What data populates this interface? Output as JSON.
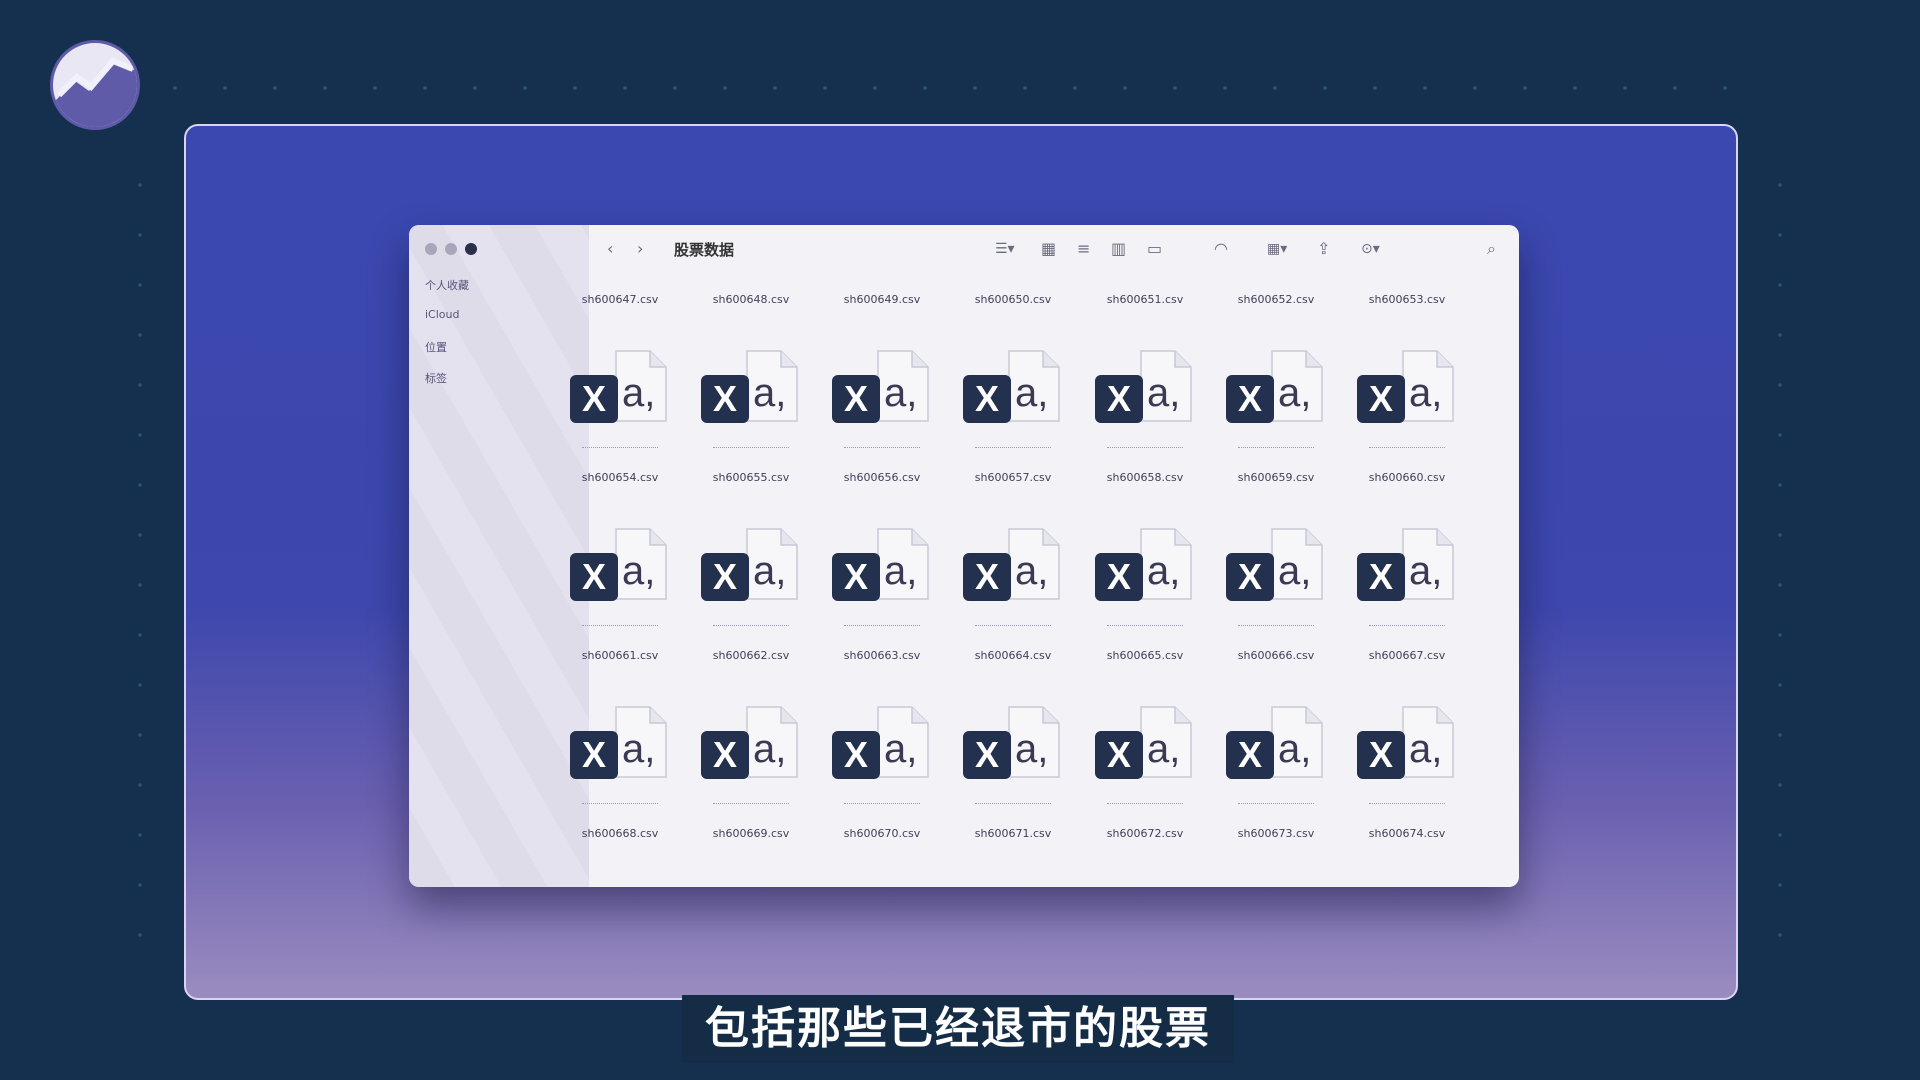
{
  "finder": {
    "folder_title": "股票数据",
    "sidebar": [
      "个人收藏",
      "iCloud",
      "位置",
      "标签"
    ],
    "file_rows": [
      [
        "sh600647.csv",
        "sh600648.csv",
        "sh600649.csv",
        "sh600650.csv",
        "sh600651.csv",
        "sh600652.csv",
        "sh600653.csv"
      ],
      [
        "sh600654.csv",
        "sh600655.csv",
        "sh600656.csv",
        "sh600657.csv",
        "sh600658.csv",
        "sh600659.csv",
        "sh600660.csv"
      ],
      [
        "sh600661.csv",
        "sh600662.csv",
        "sh600663.csv",
        "sh600664.csv",
        "sh600665.csv",
        "sh600666.csv",
        "sh600667.csv"
      ],
      [
        "sh600668.csv",
        "sh600669.csv",
        "sh600670.csv",
        "sh600671.csv",
        "sh600672.csv",
        "sh600673.csv",
        "sh600674.csv"
      ]
    ],
    "file_icon": "csv-file-icon"
  },
  "subtitle": "包括那些已经退市的股票",
  "colors": {
    "background": "#15304e",
    "frame": "#3a48b0",
    "window": "#f3f3f7",
    "icon_box": "#23304e"
  }
}
